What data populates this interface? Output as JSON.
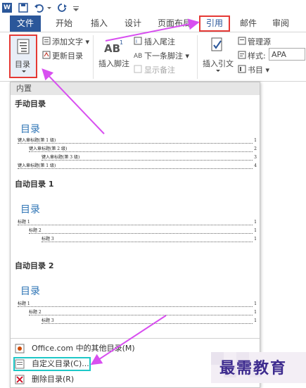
{
  "titlebar": {
    "quick_access_icons": [
      "word-logo",
      "save-icon",
      "undo-icon",
      "redo-icon",
      "customize-icon"
    ]
  },
  "tabs": {
    "file": "文件",
    "home": "开始",
    "insert": "插入",
    "design": "设计",
    "layout": "页面布局",
    "references": "引用",
    "mailings": "邮件",
    "review": "审阅"
  },
  "ribbon": {
    "toc_button": "目录",
    "add_text": "添加文字",
    "update_toc": "更新目录",
    "insert_footnote": "插入脚注",
    "insert_endnote": "插入尾注",
    "next_footnote": "下一条脚注",
    "show_notes": "显示备注",
    "insert_citation": "插入引文",
    "manage_sources": "管理源",
    "style_label": "样式:",
    "style_value": "APA",
    "bibliography": "书目",
    "group_cut": "书目",
    "ab_icon": "AB"
  },
  "panel": {
    "header": "内置",
    "manual_title": "手动目录",
    "manual_toc_head": "目录",
    "manual_lines": [
      {
        "text": "键入章标题(第 1 级)",
        "num": "1"
      },
      {
        "text": "键入章标题(第 2 级)",
        "num": "2"
      },
      {
        "text": "键入章标题(第 3 级)",
        "num": "3"
      },
      {
        "text": "键入章标题(第 1 级)",
        "num": "4"
      }
    ],
    "auto1_title": "自动目录 1",
    "auto1_toc_head": "目录",
    "auto1_lines": [
      {
        "text": "标题 1",
        "num": "1"
      },
      {
        "text": "标题 2",
        "num": "1"
      },
      {
        "text": "标题 3",
        "num": "1"
      }
    ],
    "auto2_title": "自动目录 2",
    "auto2_toc_head": "目录",
    "auto2_lines": [
      {
        "text": "标题 1",
        "num": "1"
      },
      {
        "text": "标题 2",
        "num": "1"
      },
      {
        "text": "标题 3",
        "num": "1"
      }
    ],
    "menu": {
      "more_office": "Office.com 中的其他目录(M)",
      "custom_toc": "自定义目录(C)...",
      "remove_toc": "删除目录(R)"
    }
  },
  "watermark": "最需教育",
  "colors": {
    "accent": "#2b579a",
    "highlight_red": "#e53935",
    "highlight_cyan": "#1ec8c8",
    "arrow_magenta": "#d84ff0",
    "toc_heading": "#2e74b5"
  }
}
